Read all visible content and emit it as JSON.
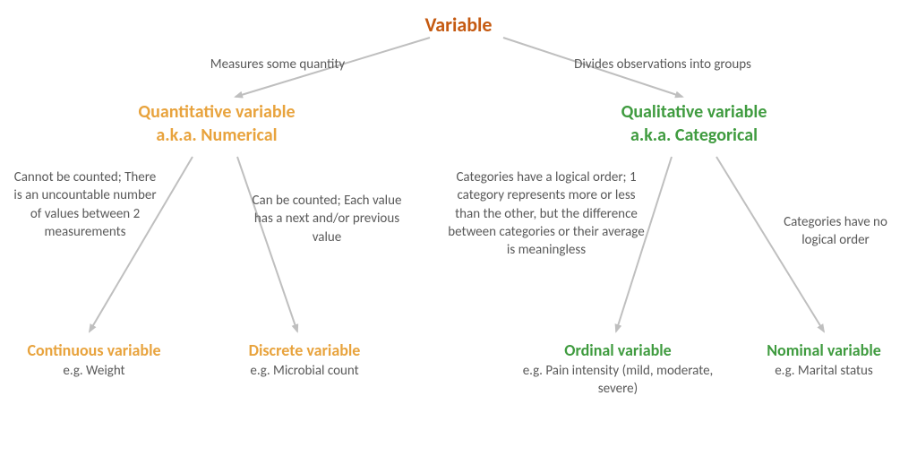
{
  "root": {
    "title": "Variable"
  },
  "edges": {
    "to_quant": "Measures some quantity",
    "to_qual": "Divides observations into groups",
    "to_continuous": "Cannot be counted; There is an uncountable number of values between 2 measurements",
    "to_discrete": "Can be counted; Each value has a next and/or previous value",
    "to_ordinal": "Categories have a logical order; 1 category represents more or less than the other, but the difference between categories or their average is meaningless",
    "to_nominal": "Categories have no logical order"
  },
  "quant": {
    "title_line1": "Quantitative variable",
    "title_line2": "a.k.a. Numerical"
  },
  "qual": {
    "title_line1": "Qualitative variable",
    "title_line2": "a.k.a. Categorical"
  },
  "continuous": {
    "title": "Continuous variable",
    "example": "e.g. Weight"
  },
  "discrete": {
    "title": "Discrete variable",
    "example": "e.g. Microbial count"
  },
  "ordinal": {
    "title": "Ordinal variable",
    "example": "e.g. Pain intensity (mild, moderate, severe)"
  },
  "nominal": {
    "title": "Nominal variable",
    "example": "e.g. Marital status"
  }
}
